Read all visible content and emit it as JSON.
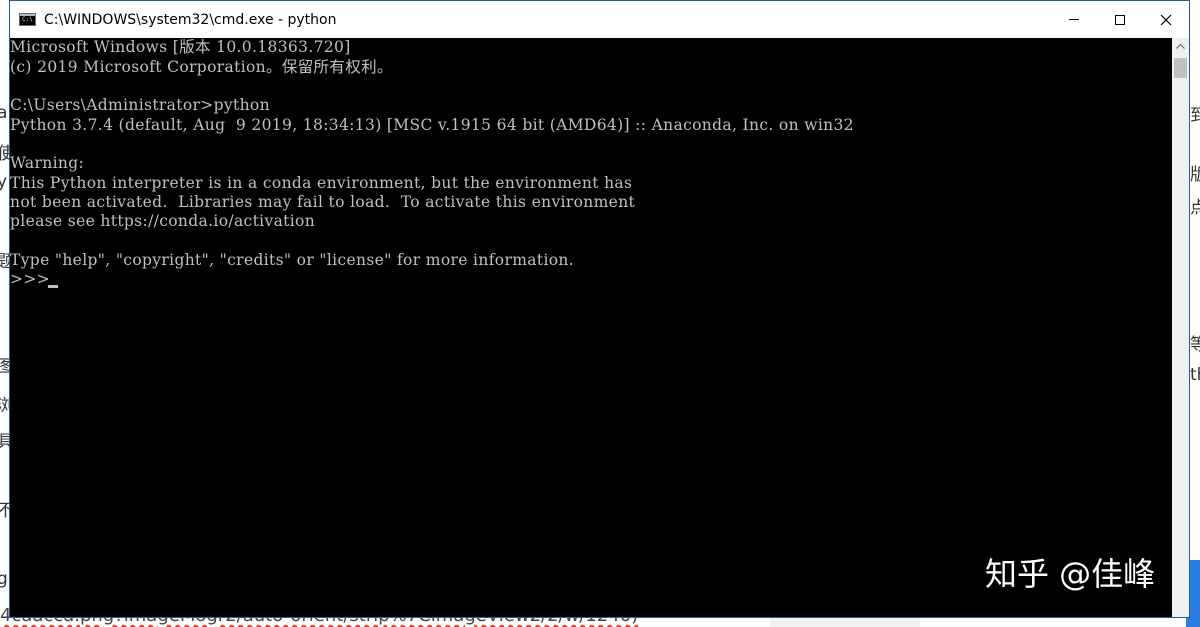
{
  "window": {
    "title": "C:\\WINDOWS\\system32\\cmd.exe - python",
    "icon": "cmd-icon",
    "icon_label": "C:\\",
    "controls": [
      "minimize-icon",
      "maximize-icon",
      "close-icon"
    ]
  },
  "console": {
    "lines": [
      "Microsoft Windows [版本 10.0.18363.720]",
      "(c) 2019 Microsoft Corporation。保留所有权利。",
      "",
      "C:\\Users\\Administrator>python",
      "Python 3.7.4 (default, Aug  9 2019, 18:34:13) [MSC v.1915 64 bit (AMD64)] :: Anaconda, Inc. on win32",
      "",
      "Warning:",
      "This Python interpreter is in a conda environment, but the environment has",
      "not been activated.  Libraries may fail to load.  To activate this environment",
      "please see https://conda.io/activation",
      "",
      "Type \"help\", \"copyright\", \"credits\" or \"license\" for more information.",
      ">>> "
    ],
    "text_color": "#c0c0c0",
    "background_color": "#000000"
  },
  "watermark": "知乎 @佳峰",
  "background_page": {
    "bottom_text": "4caacca.png?imageMogr2/auto-orient/strip%7CimageView2/2/w/1240)"
  }
}
